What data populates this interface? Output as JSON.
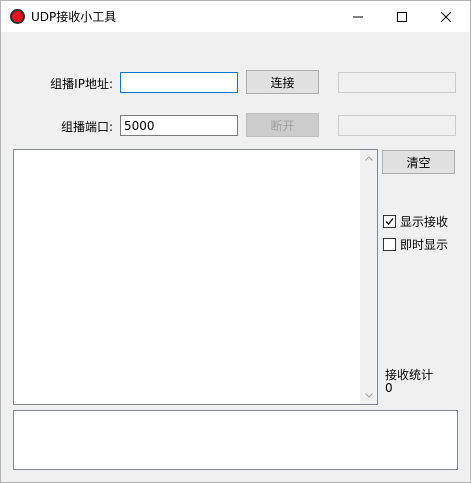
{
  "window": {
    "title": "UDP接收小工具",
    "accent_color": "#e81123"
  },
  "titlebar_controls": {
    "minimize_icon": "minimize-icon",
    "maximize_icon": "maximize-icon",
    "close_icon": "close-icon"
  },
  "form": {
    "ip_label": "组播IP地址:",
    "ip_value": "",
    "port_label": "组播端口:",
    "port_value": "5000",
    "connect_label": "连接",
    "disconnect_label": "断开"
  },
  "side": {
    "clear_label": "清空",
    "show_receive_label": "显示接收",
    "show_receive_checked": true,
    "realtime_label": "即时显示",
    "realtime_checked": false,
    "stats_label": "接收统计",
    "stats_value": "0"
  },
  "log": {
    "text": ""
  },
  "status": {
    "text": ""
  }
}
